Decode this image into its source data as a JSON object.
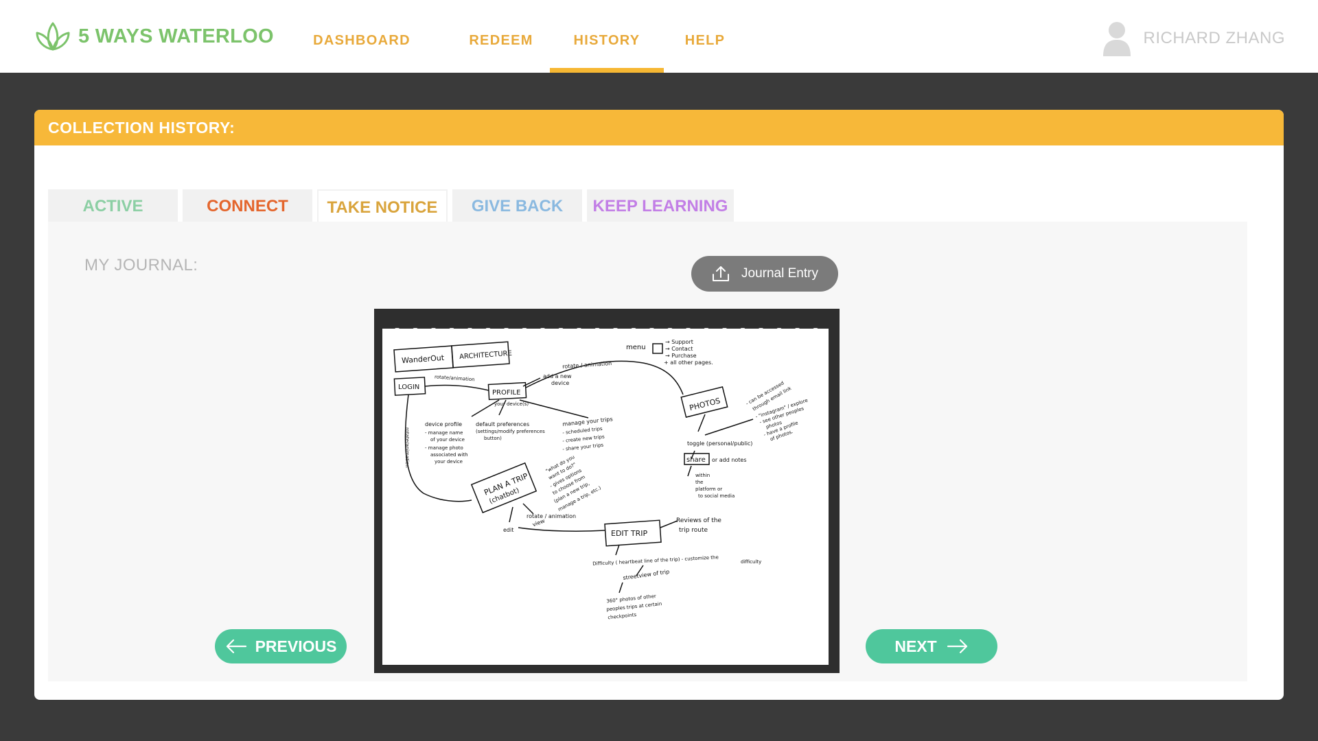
{
  "brand": {
    "name": "5 WAYS WATERLOO",
    "color": "#7cc36b"
  },
  "nav": {
    "items": [
      {
        "label": "DASHBOARD"
      },
      {
        "label": "REDEEM"
      },
      {
        "label": "HISTORY",
        "active": true
      },
      {
        "label": "HELP"
      }
    ],
    "color": "#e8a93a"
  },
  "user": {
    "name": "RICHARD ZHANG",
    "icon": "user-avatar-icon"
  },
  "collection": {
    "header": "COLLECTION HISTORY:",
    "header_color": "#f7b839",
    "tabs": [
      {
        "label": "ACTIVE",
        "color": "#8ccfa4"
      },
      {
        "label": "CONNECT",
        "color": "#e4662d"
      },
      {
        "label": "TAKE NOTICE",
        "color": "#d9a43c",
        "active": true
      },
      {
        "label": "GIVE BACK",
        "color": "#8ab9e0"
      },
      {
        "label": "KEEP LEARNING",
        "color": "#c27ee6"
      }
    ]
  },
  "journal": {
    "label": "MY JOURNAL:",
    "upload_label": "Journal Entry",
    "upload_icon": "upload-icon",
    "sketch": {
      "title_left": "WanderOut",
      "title_right": "ARCHITECTURE",
      "login": "LOGIN",
      "profile": "PROFILE",
      "photos": "PHOTOS",
      "plan_a_trip": "PLAN A TRIP",
      "chatbot": "(chatbot)",
      "edit_trip": "EDIT TRIP",
      "share": "share",
      "menu": "menu",
      "support": "→ Support",
      "contact": "→ Contact",
      "purchase": "→ Purchase",
      "other_pages": "+ all other pages.",
      "rotate_animation_1": "rotate / animation",
      "rotate_animation_2": "rotate/animation",
      "rotate_animation_3": "rotate / animation",
      "rotate_animation_4": "rotate/animation",
      "add_device_1": "add a new",
      "add_device_2": "device",
      "your_devices": "your device(s)",
      "device_profile": "device profile",
      "manage_name": "- manage name",
      "of_your_device": "of your device",
      "manage_photo": "- manage photo",
      "associated_with": "associated with",
      "your_device": "your device",
      "default_prefs": "default preferences",
      "settings_modify": "(settings/modify preferences",
      "button": "button)",
      "manage_trips": "manage your trips",
      "scheduled_trips": "- scheduled trips",
      "create_trips": "- create new trips",
      "share_trips": "- share your trips",
      "can_be_accessed_1": "- can be accessed",
      "can_be_accessed_2": "through email link",
      "instagram_1": "- \"instagram\" / explore",
      "instagram_2": "- see other peoples",
      "instagram_3": "photos",
      "have_profile_1": "- have a profile",
      "have_profile_2": "of photos.",
      "toggle": "toggle (personal/public)",
      "or_add_notes": "or add notes",
      "within": "within",
      "the": "the",
      "platform_or": "platform or",
      "to_social": "to social media",
      "what_1": "\"what do you",
      "what_2": "want to do?\"",
      "what_3": "- gives options",
      "what_4": "to choose from",
      "what_5": "(plan a new trip,",
      "what_6": "manage a trip, etc.)",
      "edit": "edit",
      "view": "view",
      "reviews_1": "Reviews of the",
      "reviews_2": "trip route",
      "difficulty": "Difficulty ( heartbeat line of the trip) - customize the",
      "difficulty_2": "difficulty",
      "streetview": "streetview of trip",
      "photos360_1": "360° photos of other",
      "photos360_2": "peoples trips at certain",
      "photos360_3": "checkpoints"
    }
  },
  "pager": {
    "previous_label": "PREVIOUS",
    "next_label": "NEXT",
    "color": "#4fc79c"
  }
}
